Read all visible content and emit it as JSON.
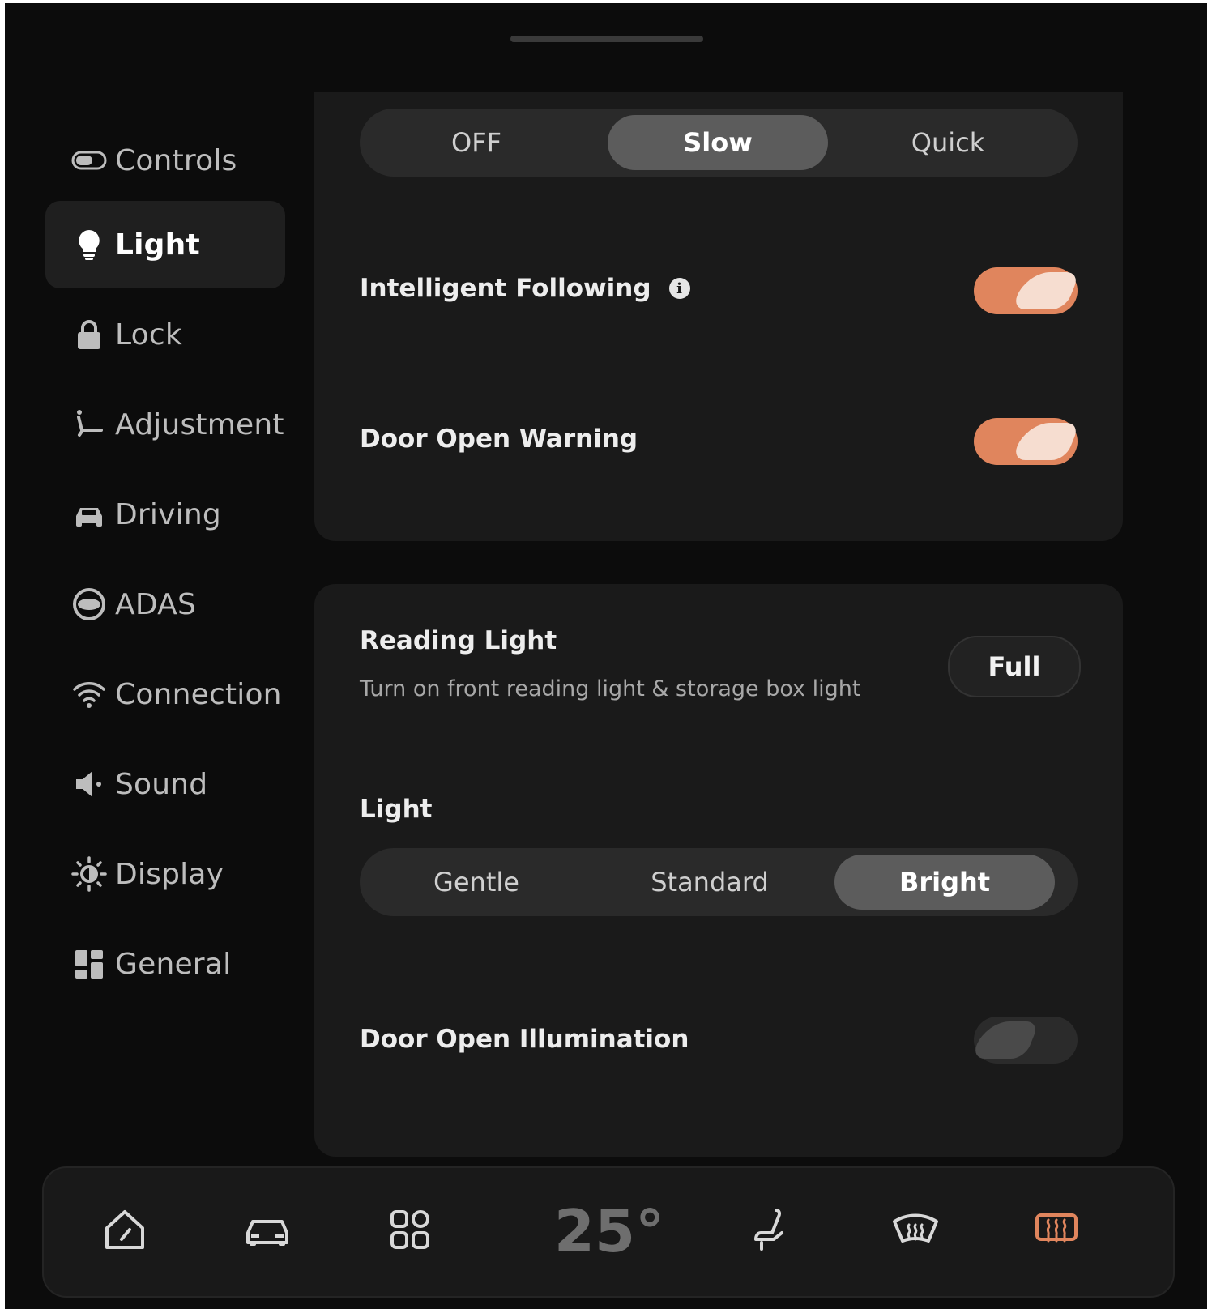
{
  "sidebar": {
    "items": [
      {
        "label": "Controls",
        "icon": "toggle-icon"
      },
      {
        "label": "Light",
        "icon": "bulb-icon",
        "active": true
      },
      {
        "label": "Lock",
        "icon": "lock-icon"
      },
      {
        "label": "Adjustment",
        "icon": "seat-icon"
      },
      {
        "label": "Driving",
        "icon": "car-icon"
      },
      {
        "label": "ADAS",
        "icon": "adas-icon"
      },
      {
        "label": "Connection",
        "icon": "wifi-icon"
      },
      {
        "label": "Sound",
        "icon": "speaker-icon"
      },
      {
        "label": "Display",
        "icon": "brightness-icon"
      },
      {
        "label": "General",
        "icon": "grid-icon"
      }
    ]
  },
  "top_card": {
    "mode_segments": {
      "options": [
        "OFF",
        "Slow",
        "Quick"
      ],
      "selected": "Slow"
    },
    "intelligent_following": {
      "label": "Intelligent Following",
      "on": true
    },
    "door_open_warning": {
      "label": "Door Open Warning",
      "on": true
    }
  },
  "bottom_card": {
    "reading_light": {
      "title": "Reading Light",
      "subtitle": "Turn on front reading light & storage box light",
      "button_label": "Full"
    },
    "light": {
      "label": "Light",
      "options": [
        "Gentle",
        "Standard",
        "Bright"
      ],
      "selected": "Bright"
    },
    "door_open_illumination": {
      "label": "Door Open Illumination",
      "on": false
    }
  },
  "dock": {
    "temperature": "25°",
    "buttons": [
      "home-icon",
      "car-icon",
      "apps-icon",
      "seat-icon",
      "front-defrost-icon",
      "rear-defrost-icon"
    ]
  },
  "colors": {
    "accent": "#e0855d",
    "background": "#0c0c0c",
    "card": "#1a1a1a"
  }
}
